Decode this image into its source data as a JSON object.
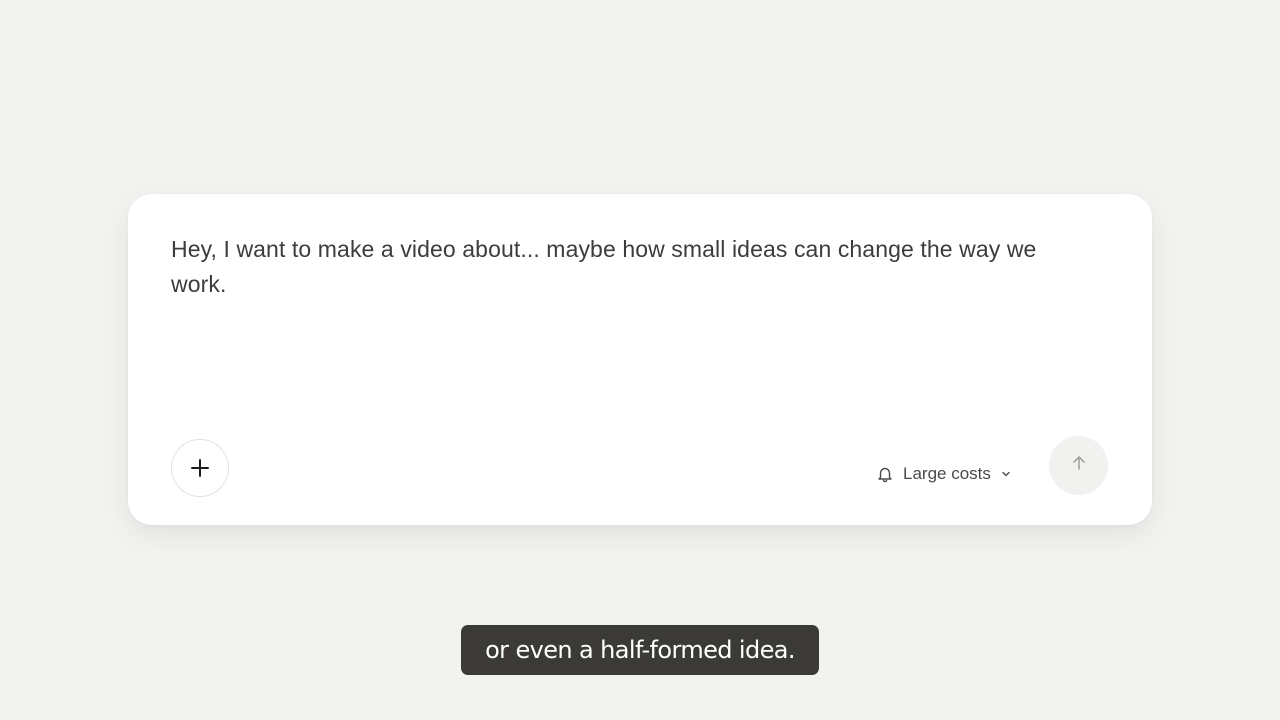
{
  "composer": {
    "prompt_text": "Hey, I want to make a video about... maybe how small ideas can change the way we work.",
    "add_button": {
      "icon": "plus-icon"
    },
    "model_selector": {
      "icon": "bell-icon",
      "label": "Large costs",
      "chevron_icon": "chevron-down-icon"
    },
    "send_button": {
      "icon": "arrow-up-icon"
    }
  },
  "caption": {
    "text": "or even a half-formed idea."
  },
  "colors": {
    "background": "#f2f2f0",
    "card": "#ffffff",
    "text": "#3c3c3a",
    "caption_bg": "#3b3a36",
    "caption_text": "#ffffff"
  }
}
